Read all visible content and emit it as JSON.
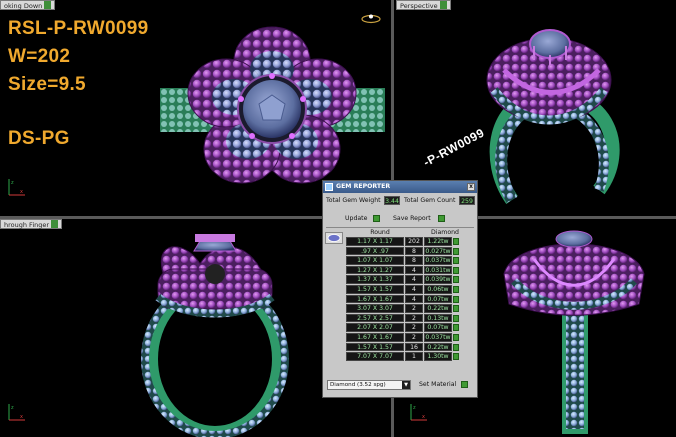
{
  "viewports": {
    "top_left": {
      "label": "oking Down"
    },
    "top_right": {
      "label": "Perspective"
    },
    "bottom_left": {
      "label": "hrough Finger"
    },
    "bottom_right": {
      "label": ""
    }
  },
  "specs": {
    "model": "RSL-P-RW0099",
    "weight": "W=202",
    "size": "Size=9.5",
    "designer": "DS-PG"
  },
  "watermark": "-P-RW0099",
  "gem_reporter": {
    "title": "GEM REPORTER",
    "close_label": "x",
    "total_weight_label": "Total Gem Weight",
    "total_weight_value": "3.44",
    "total_count_label": "Total Gem Count",
    "total_count_value": "259",
    "update_label": "Update",
    "save_report_label": "Save Report",
    "col_shape": "Round",
    "col_material": "Diamond",
    "rows": [
      {
        "size": "1.17 X 1.17",
        "count": "202",
        "weight": "1.22tw"
      },
      {
        "size": ".97 X .97",
        "count": "8",
        "weight": "0.027tw"
      },
      {
        "size": "1.07 X 1.07",
        "count": "8",
        "weight": "0.037tw"
      },
      {
        "size": "1.27 X 1.27",
        "count": "4",
        "weight": "0.031tw"
      },
      {
        "size": "1.37 X 1.37",
        "count": "4",
        "weight": "0.039tw"
      },
      {
        "size": "1.57 X 1.57",
        "count": "4",
        "weight": "0.06tw"
      },
      {
        "size": "1.67 X 1.67",
        "count": "4",
        "weight": "0.07tw"
      },
      {
        "size": "3.07 X 3.07",
        "count": "2",
        "weight": "0.22tw"
      },
      {
        "size": "2.57 X 2.57",
        "count": "2",
        "weight": "0.13tw"
      },
      {
        "size": "2.07 X 2.07",
        "count": "2",
        "weight": "0.07tw"
      },
      {
        "size": "1.67 X 1.67",
        "count": "2",
        "weight": "0.037tw"
      },
      {
        "size": "1.57 X 1.57",
        "count": "16",
        "weight": "0.22tw"
      },
      {
        "size": "7.07 X 7.07",
        "count": "1",
        "weight": "1.30tw"
      }
    ],
    "material_select": "Diamond   (3.52 spg)",
    "set_material_label": "Set Material"
  },
  "colors": {
    "spec_text": "#f0a92e",
    "shank": "#3faa7a",
    "gem_purple": "#b060d0",
    "gem_blue": "#8fa8d8",
    "center_stone": "#5c6ea0"
  }
}
